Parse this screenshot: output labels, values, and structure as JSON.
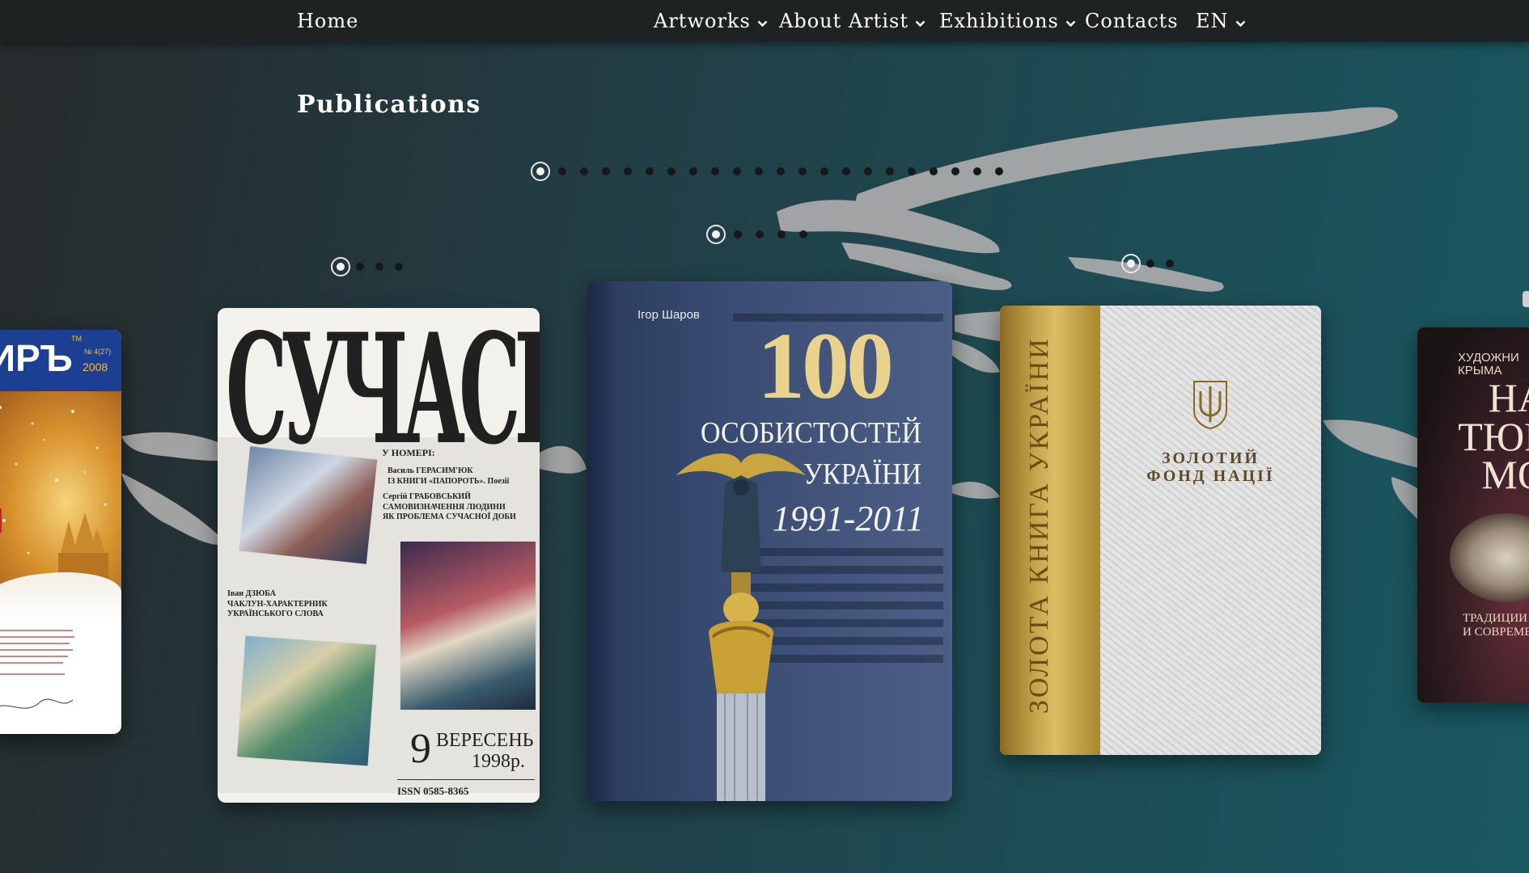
{
  "nav": {
    "home": "Home",
    "artworks": "Artworks",
    "about_artist": "About Artist",
    "exhibitions": "Exhibitions",
    "contacts": "Contacts",
    "language": "EN"
  },
  "page": {
    "title": "Publications"
  },
  "pagers": {
    "main": {
      "count": 22,
      "active": 0
    },
    "center": {
      "count": 5,
      "active": 0
    },
    "left": {
      "count": 4,
      "active": 0
    },
    "right": {
      "count": 3,
      "active": 0
    }
  },
  "covers": {
    "mir": {
      "title": "ИРЪ",
      "tm": "TM",
      "issue": "№ 4(27)",
      "year": "2008"
    },
    "suchasnist": {
      "title": "СУЧАСНІСТЬ",
      "in_issue": "У НОМЕРІ:",
      "item1": "Василь ГЕРАСИМ'ЮК\nІЗ КНИГИ «ПАПОРОТЬ». Поезії",
      "item2": "Сергій ГРАБОВСЬКИЙ\nСАМОВИЗНАЧЕННЯ ЛЮДИНИ\nЯК ПРОБЛЕМА СУЧАСНОЇ ДОБИ",
      "item3": "Іван ДЗЮБА\nЧАКЛУН-ХАРАКТЕРНИК\nУКРАЇНСЬКОГО СЛОВА",
      "issue_number": "9",
      "month": "ВЕРЕСЕНЬ",
      "year": "1998р.",
      "issn": "ISSN 0585-8365"
    },
    "hundred": {
      "author": "Ігор Шаров",
      "number": "100",
      "line1": "ОСОБИСТОСТЕЙ",
      "line2": "УКРАЇНИ",
      "years": "1991-2011"
    },
    "golden": {
      "spine": "ЗОЛОТА КНИГА УКРАЇНИ",
      "line1": "ЗОЛОТИЙ",
      "line2": "ФОНД НАЦІЇ"
    },
    "crimea": {
      "head": "ХУДОЖНИ\nКРЫМА",
      "big": "НА\nТЮР\nМО",
      "sub": "ТРАДИЦИИ\nИ СОВРЕМЕН"
    }
  }
}
